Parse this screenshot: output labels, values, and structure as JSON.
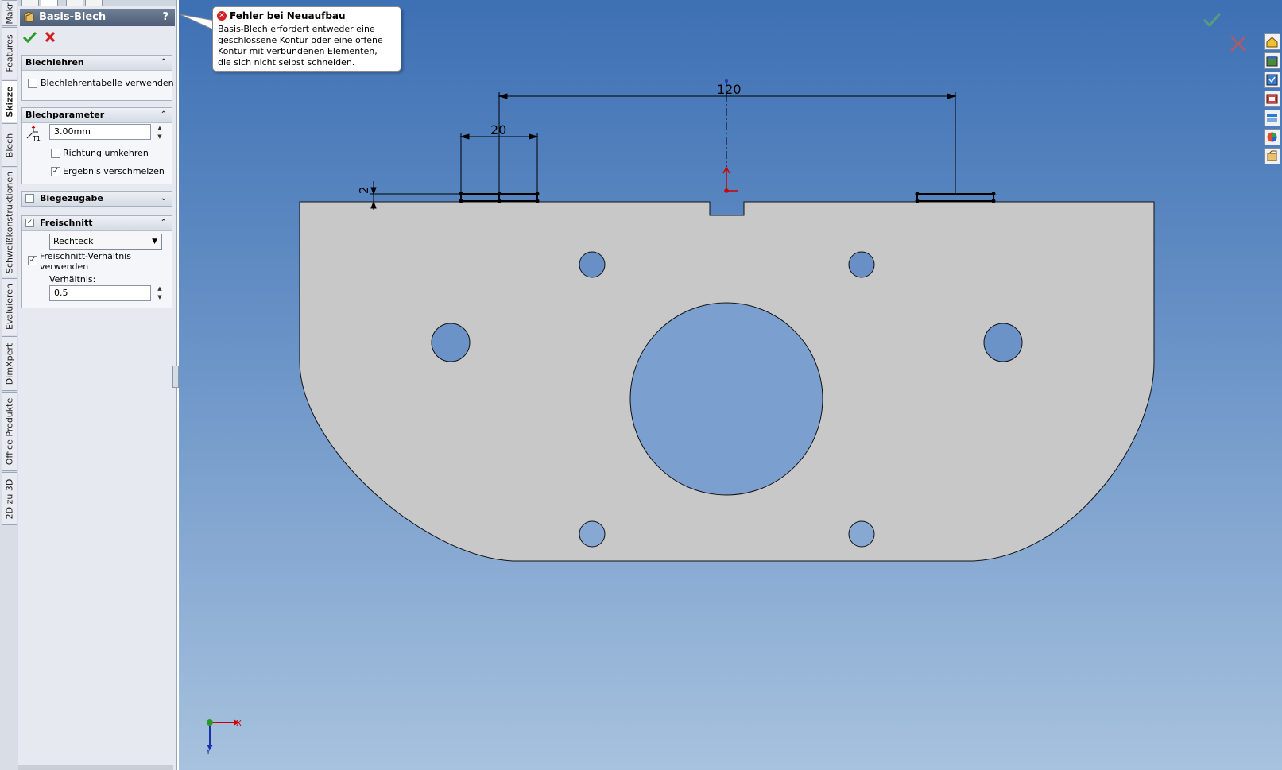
{
  "vertical_tabs": [
    {
      "label": "Makr",
      "active": false
    },
    {
      "label": "Features",
      "active": false
    },
    {
      "label": "Skizze",
      "active": true
    },
    {
      "label": "Blech",
      "active": false
    },
    {
      "label": "Schweißkonstruktionen",
      "active": false
    },
    {
      "label": "Evaluieren",
      "active": false
    },
    {
      "label": "DimXpert",
      "active": false
    },
    {
      "label": "Office Produkte",
      "active": false
    },
    {
      "label": "2D zu 3D",
      "active": false
    }
  ],
  "property_manager": {
    "title": "Basis-Blech",
    "help": "?",
    "title_icon": "sheet-metal-icon",
    "ok_icon": "checkmark-icon",
    "cancel_icon": "x-icon",
    "groups": {
      "blechlehren": {
        "title": "Blechlehren",
        "chevron": "⌃",
        "use_table_label": "Blechlehrentabelle verwenden",
        "use_table_checked": false
      },
      "blechparameter": {
        "title": "Blechparameter",
        "chevron": "⌃",
        "thickness_icon": "T1",
        "thickness_value": "3.00mm",
        "reverse_label": "Richtung umkehren",
        "reverse_checked": false,
        "merge_label": "Ergebnis verschmelzen",
        "merge_checked": true
      },
      "biegezugabe": {
        "title": "Biegezugabe",
        "chevron": "⌄",
        "checked": false
      },
      "freischnitt": {
        "title": "Freischnitt",
        "chevron": "⌃",
        "checked": true,
        "type_value": "Rechteck",
        "ratio_checkbox_label_1": "Freischnitt-Verhältnis",
        "ratio_checkbox_label_2": "verwenden",
        "ratio_checked": true,
        "ratio_label": "Verhältnis:",
        "ratio_value": "0.5"
      }
    }
  },
  "error_tooltip": {
    "title": "Fehler bei Neuaufbau",
    "lines": [
      "Basis-Blech erfordert entweder eine",
      "geschlossene Kontur oder eine offene",
      "Kontur mit verbundenen Elementen,",
      "die sich nicht selbst schneiden."
    ]
  },
  "sketch": {
    "dimensions": {
      "overall": "120",
      "tab_width": "20",
      "tab_height": "2"
    },
    "triad": {
      "x": "X",
      "y": "Y"
    }
  },
  "colors": {
    "part_fill": "#c8c8c8",
    "viewport_top": "#3d70b4",
    "viewport_bottom": "#a7c2de",
    "ok_green": "#2a9a2a",
    "cancel_red": "#d41e1e"
  },
  "task_pane_icons": [
    "home-icon",
    "design-library-icon",
    "file-explorer-icon",
    "view-palette-icon",
    "appearances-icon",
    "custom-properties-icon",
    "documents-icon"
  ]
}
